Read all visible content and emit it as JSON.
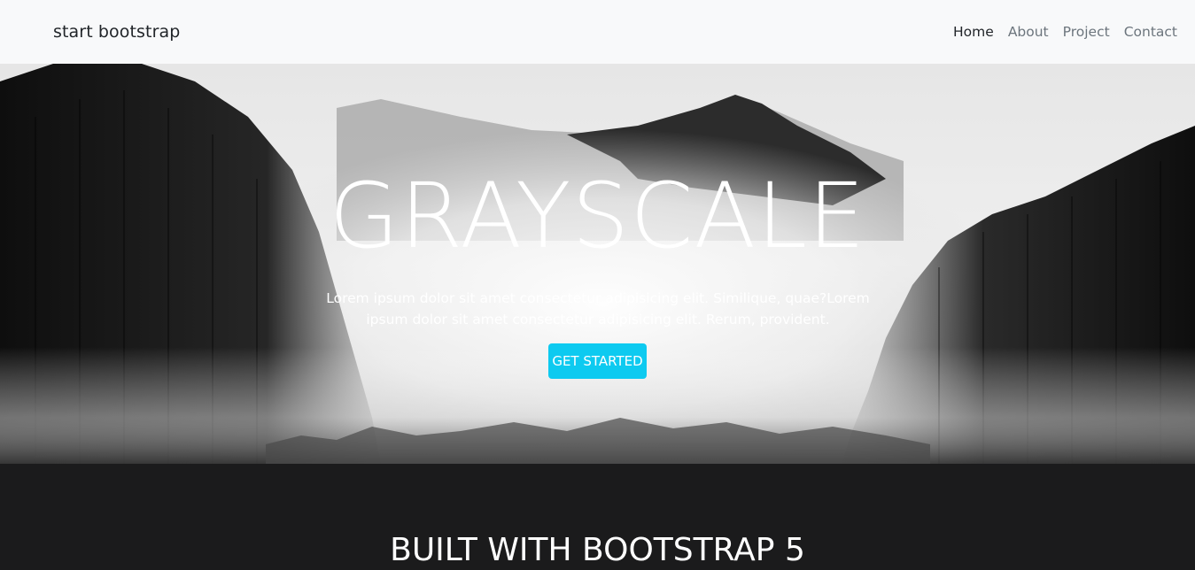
{
  "navbar": {
    "brand": "start bootstrap",
    "links": [
      {
        "label": "Home",
        "active": true
      },
      {
        "label": "About",
        "active": false
      },
      {
        "label": "Project",
        "active": false
      },
      {
        "label": "Contact",
        "active": false
      }
    ]
  },
  "hero": {
    "title": "GRAYSCALE",
    "description": "Lorem ipsum dolor sit amet consectetur adipisicing elit. Similique, quae?Lorem ipsum dolor sit amet consectetur adipisicing elit. Rerum, provident.",
    "button_label": "GET STARTED",
    "background": "misty-mountain-forest-grayscale"
  },
  "section": {
    "title": "BUILT WITH BOOTSTRAP 5"
  },
  "colors": {
    "navbar_bg": "#f8f9fa",
    "accent": "#0dcaf0",
    "dark_bg": "#1b1b1c"
  }
}
